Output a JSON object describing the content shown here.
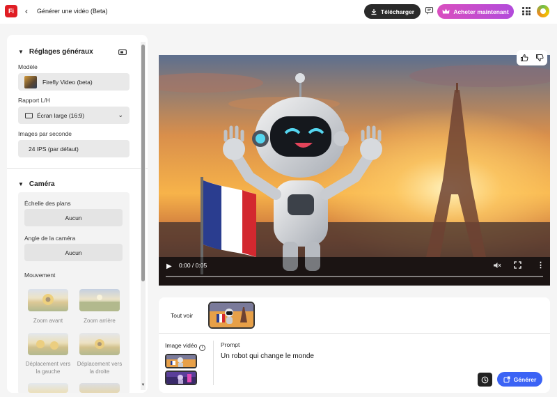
{
  "header": {
    "logo_text": "Fi",
    "back_icon": "chevron-left-icon",
    "title": "Générer une vidéo (Beta)",
    "download_label": "Télécharger",
    "buy_label": "Acheter maintenant",
    "accent_buy": "#c94fd0",
    "accent_download": "#2a2a2a"
  },
  "sidebar": {
    "general": {
      "heading": "Réglages généraux",
      "model_label": "Modèle",
      "model_value": "Firefly Video (beta)",
      "ratio_label": "Rapport L/H",
      "ratio_value": "Écran large (16:9)",
      "fps_label": "Images par seconde",
      "fps_value": "24 IPS (par défaut)"
    },
    "camera": {
      "heading": "Caméra",
      "shot_label": "Échelle des plans",
      "shot_value": "Aucun",
      "angle_label": "Angle de la caméra",
      "angle_value": "Aucun",
      "motion_label": "Mouvement",
      "motions": [
        {
          "label": "Zoom avant"
        },
        {
          "label": "Zoom arrière"
        },
        {
          "label": "Déplacement vers la gauche"
        },
        {
          "label": "Déplacement vers la droite"
        }
      ]
    }
  },
  "player": {
    "time": "0:00 / 0:05",
    "progress": 0
  },
  "gallery": {
    "see_all": "Tout voir"
  },
  "prompt": {
    "image_label": "Image vidéo",
    "prompt_label": "Prompt",
    "prompt_text": "Un robot qui change le monde",
    "generate_label": "Générer",
    "accent_generate": "#3b63f5"
  }
}
